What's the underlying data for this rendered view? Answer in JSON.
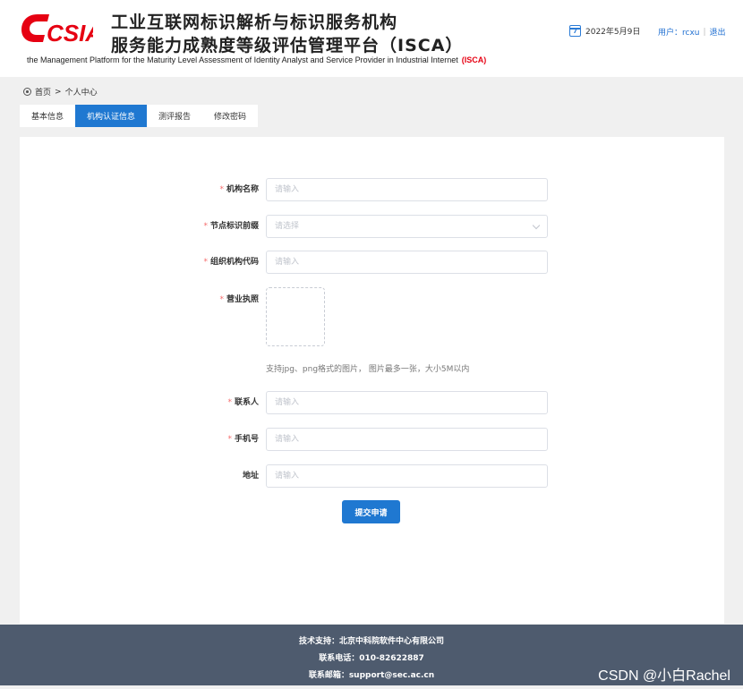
{
  "header": {
    "logo_text": "CSIA",
    "title_line1": "工业互联网标识解析与标识服务机构",
    "title_line2": "服务能力成熟度等级评估管理平台（ISCA）",
    "subtitle": "the Management Platform for the Maturity Level Assessment of Identity Analyst and Service Provider in Industrial Internet",
    "subtitle_tag": "(ISCA)",
    "date": "2022年5月9日",
    "user_label": "用户：rcxu",
    "logout": "退出",
    "brand_color": "#e60012",
    "accent_color": "#1f78d1"
  },
  "breadcrumb": {
    "icon": "location-icon",
    "home": "首页",
    "separator": ">",
    "current": "个人中心"
  },
  "tabs": [
    {
      "label": "基本信息",
      "active": false
    },
    {
      "label": "机构认证信息",
      "active": true
    },
    {
      "label": "测评报告",
      "active": false
    },
    {
      "label": "修改密码",
      "active": false
    }
  ],
  "form": {
    "org_name": {
      "label": "机构名称",
      "placeholder": "请输入",
      "required": "*"
    },
    "node_prefix": {
      "label": "节点标识前缀",
      "placeholder": "请选择",
      "required": "*"
    },
    "org_code": {
      "label": "组织机构代码",
      "placeholder": "请输入",
      "required": "*"
    },
    "license": {
      "label": "营业执照",
      "required": "*",
      "hint": "支持jpg、png格式的图片， 图片最多一张，大小5M以内"
    },
    "contact": {
      "label": "联系人",
      "placeholder": "请输入",
      "required": "*"
    },
    "phone": {
      "label": "手机号",
      "placeholder": "请输入",
      "required": "*"
    },
    "address": {
      "label": "地址",
      "placeholder": "请输入"
    },
    "submit_label": "提交申请"
  },
  "footer": {
    "support": "技术支持：北京中科院软件中心有限公司",
    "tel": "联系电话：010-82622887",
    "email": "联系邮箱：support@sec.ac.cn",
    "watermark": "CSDN @小白Rachel"
  }
}
